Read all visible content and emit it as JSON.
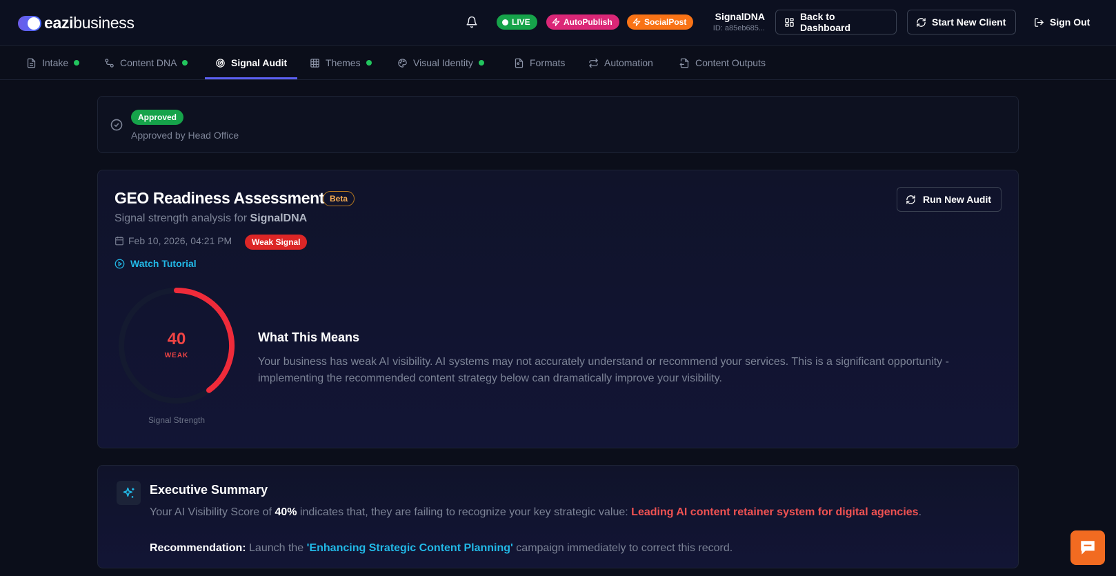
{
  "header": {
    "logo_bold": "eazi",
    "logo_light": "business",
    "badges": {
      "live": "LIVE",
      "autopublish": "AutoPublish",
      "socialpost": "SocialPost"
    },
    "client_name": "SignalDNA",
    "client_id": "ID: a85eb685...",
    "back_dashboard": "Back to Dashboard",
    "start_new_client": "Start New Client",
    "sign_out": "Sign Out"
  },
  "tabs": [
    {
      "label": "Intake",
      "complete": true
    },
    {
      "label": "Content DNA",
      "complete": true
    },
    {
      "label": "Signal Audit",
      "active": true
    },
    {
      "label": "Themes",
      "complete": true
    },
    {
      "label": "Visual Identity",
      "complete": true
    },
    {
      "label": "Formats"
    },
    {
      "label": "Automation"
    },
    {
      "label": "Content Outputs"
    }
  ],
  "approval": {
    "badge": "Approved",
    "text": "Approved by Head Office"
  },
  "geo": {
    "title": "GEO Readiness Assessment",
    "beta": "Beta",
    "subtitle_prefix": "Signal strength analysis for ",
    "subtitle_client": "SignalDNA",
    "date": "Feb 10, 2026, 04:21 PM",
    "signal_badge": "Weak Signal",
    "watch_tutorial": "Watch Tutorial",
    "run_new_audit": "Run New Audit",
    "score": "40",
    "score_value": 40,
    "score_max": 100,
    "score_label": "WEAK",
    "gauge_caption": "Signal Strength",
    "means_title": "What This Means",
    "means_body": "Your business has weak AI visibility. AI systems may not accurately understand or recommend your services. This is a significant opportunity - implementing the recommended content strategy below can dramatically improve your visibility."
  },
  "executive": {
    "title": "Executive Summary",
    "p1_a": "Your AI Visibility Score of ",
    "p1_score": "40%",
    "p1_b": " indicates that, they are failing to recognize your key strategic value: ",
    "p1_value": "Leading AI content retainer system for digital agencies",
    "p1_end": ".",
    "rec_label": "Recommendation:",
    "rec_a": " Launch the ",
    "rec_campaign": "'Enhancing Strategic Content Planning'",
    "rec_b": " campaign immediately to correct this record."
  },
  "colors": {
    "accent": "#5b5ff0",
    "live": "#16a34a",
    "autopublish": "#db2777",
    "socialpost": "#f97316",
    "weak": "#ef4444",
    "link": "#22b8e6"
  }
}
